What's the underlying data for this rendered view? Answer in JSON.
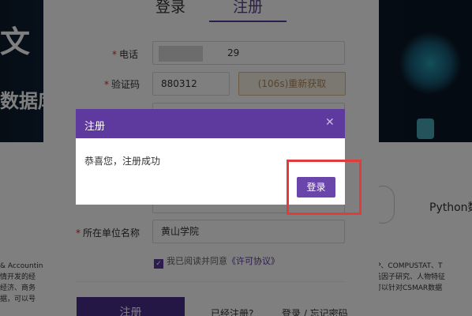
{
  "background": {
    "banner_title_char": "文",
    "banner_sub": "数据库",
    "python_label": "Python数",
    "left_text": [
      "& Accounting",
      "情开发的经",
      "经济、商务",
      "据，可以号"
    ],
    "right_text": [
      "RSP、COMPUSTAT、T",
      "她盖因子研究、人物特征",
      "块可以针对CSMAR数据"
    ]
  },
  "form": {
    "tabs": {
      "login": "登录",
      "register": "注册"
    },
    "rows": [
      {
        "label": "电话",
        "value": "29"
      },
      {
        "label": "验证码",
        "value": "880312"
      },
      {
        "label": "所在单位名称",
        "value": "黄山学院"
      }
    ],
    "resend_button": "(106s)重新获取",
    "agree_text": "我已阅读并同意",
    "agree_link": "《许可协议》",
    "submit_button": "注册",
    "already_text": "已经注册?",
    "login_forgot_text": "登录 / 忘记密码"
  },
  "modal": {
    "title": "注册",
    "message": "恭喜您，注册成功",
    "login_button": "登录"
  },
  "colors": {
    "primary": "#5f3a9e",
    "highlight": "#e23b3b"
  }
}
